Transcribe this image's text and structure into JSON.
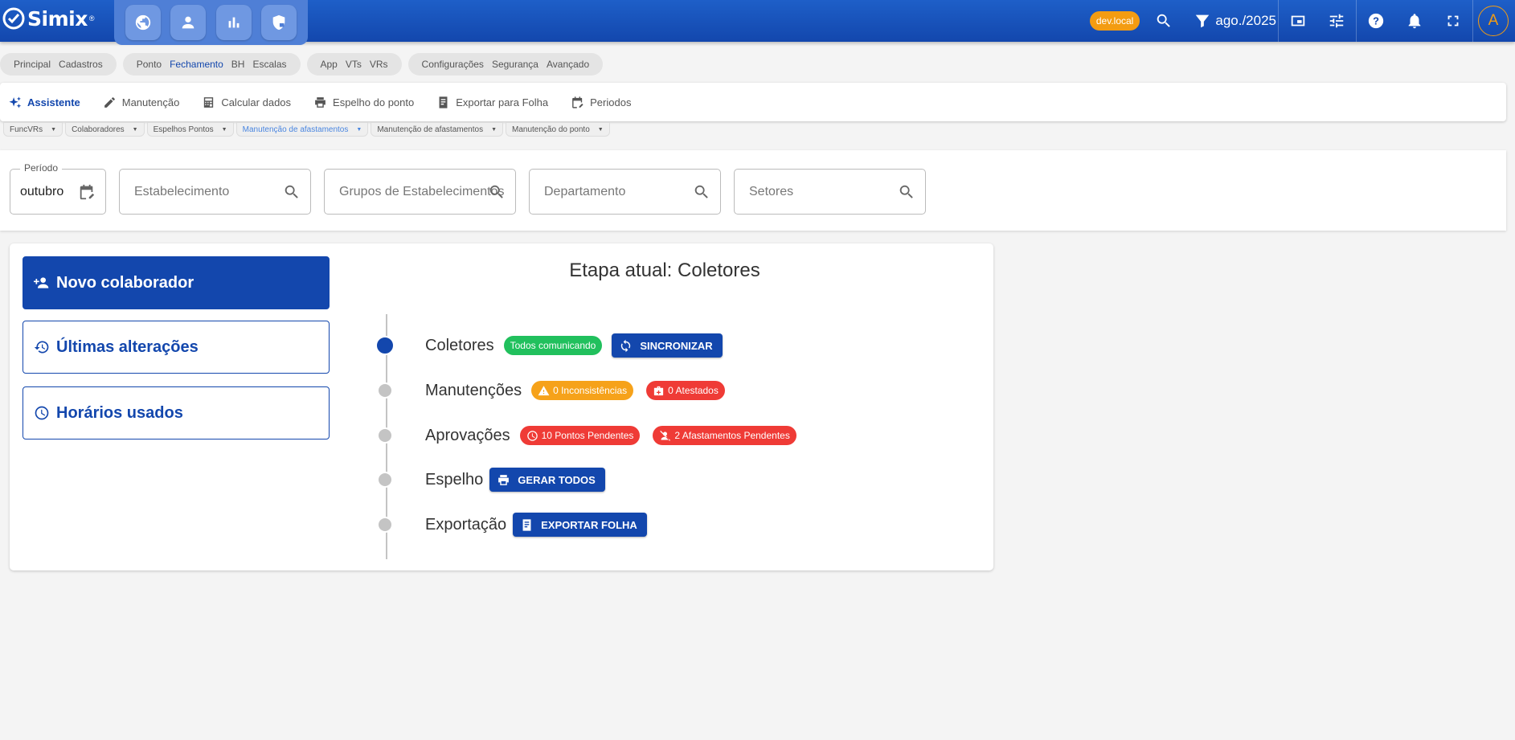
{
  "app": {
    "name": "Simix",
    "registered": "®"
  },
  "header": {
    "env_badge": "dev.local",
    "period": "ago./2025",
    "avatar_initial": "A",
    "modules": [
      {
        "icon": "globe-icon"
      },
      {
        "icon": "person-icon"
      },
      {
        "icon": "bar-chart-icon"
      },
      {
        "icon": "shield-lock-icon"
      }
    ]
  },
  "menu_groups": [
    {
      "items": [
        {
          "label": "Principal"
        },
        {
          "label": "Cadastros"
        }
      ]
    },
    {
      "items": [
        {
          "label": "Ponto"
        },
        {
          "label": "Fechamento",
          "active": true
        },
        {
          "label": "BH"
        },
        {
          "label": "Escalas"
        }
      ]
    },
    {
      "items": [
        {
          "label": "App"
        },
        {
          "label": "VTs"
        },
        {
          "label": "VRs"
        }
      ]
    },
    {
      "items": [
        {
          "label": "Configurações"
        },
        {
          "label": "Segurança"
        },
        {
          "label": "Avançado"
        }
      ]
    }
  ],
  "toolbar": {
    "items": [
      {
        "label": "Assistente",
        "icon": "sparkle-icon",
        "active": true
      },
      {
        "label": "Manutenção",
        "icon": "pencil-icon"
      },
      {
        "label": "Calcular dados",
        "icon": "calculator-icon"
      },
      {
        "label": "Espelho do ponto",
        "icon": "printer-icon"
      },
      {
        "label": "Exportar para Folha",
        "icon": "document-icon"
      },
      {
        "label": "Periodos",
        "icon": "calendar-edit-icon"
      }
    ]
  },
  "open_tabs": [
    {
      "label": "FuncVRs"
    },
    {
      "label": "Colaboradores"
    },
    {
      "label": "Espelhos Pontos"
    },
    {
      "label": "Manutenção de afastamentos",
      "active": true
    },
    {
      "label": "Manutenção de afastamentos"
    },
    {
      "label": "Manutenção do ponto"
    }
  ],
  "filters": {
    "period": {
      "legend": "Período",
      "value": "outubro"
    },
    "establishment": {
      "placeholder": "Estabelecimento"
    },
    "establishment_groups": {
      "placeholder": "Grupos de Estabelecimentos"
    },
    "department": {
      "placeholder": "Departamento"
    },
    "sectors": {
      "placeholder": "Setores"
    }
  },
  "side_actions": {
    "new_employee": "Novo colaborador",
    "recent_changes": "Últimas alterações",
    "used_schedules": "Horários usados"
  },
  "stage": {
    "title": "Etapa atual: Coletores",
    "steps": [
      {
        "label": "Coletores",
        "chips": [
          {
            "text": "Todos comunicando",
            "color": "#21c05d"
          }
        ],
        "button": "SINCRONIZAR",
        "active": true
      },
      {
        "label": "Manutenções",
        "chips": [
          {
            "text": "0 Inconsistências",
            "color": "#f6a21a"
          },
          {
            "text": "0 Atestados",
            "color": "#ef3b36"
          }
        ]
      },
      {
        "label": "Aprovações",
        "chips": [
          {
            "text": "10 Pontos Pendentes",
            "color": "#ef3b36"
          },
          {
            "text": "2 Afastamentos Pendentes",
            "color": "#ef3b36"
          }
        ]
      },
      {
        "label": "Espelho",
        "button": "GERAR TODOS"
      },
      {
        "label": "Exportação",
        "button": "EXPORTAR FOLHA"
      }
    ]
  },
  "colors": {
    "primary": "#1347ad",
    "accent": "#f39c12",
    "success": "#21c05d",
    "warning": "#f6a21a",
    "danger": "#ef3b36"
  }
}
